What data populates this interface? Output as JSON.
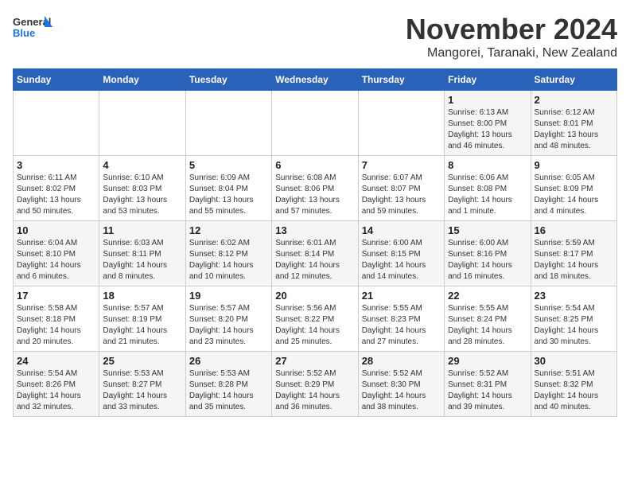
{
  "logo": {
    "line1": "General",
    "line2": "Blue"
  },
  "title": "November 2024",
  "subtitle": "Mangorei, Taranaki, New Zealand",
  "days_of_week": [
    "Sunday",
    "Monday",
    "Tuesday",
    "Wednesday",
    "Thursday",
    "Friday",
    "Saturday"
  ],
  "weeks": [
    [
      {
        "day": "",
        "info": ""
      },
      {
        "day": "",
        "info": ""
      },
      {
        "day": "",
        "info": ""
      },
      {
        "day": "",
        "info": ""
      },
      {
        "day": "",
        "info": ""
      },
      {
        "day": "1",
        "info": "Sunrise: 6:13 AM\nSunset: 8:00 PM\nDaylight: 13 hours and 46 minutes."
      },
      {
        "day": "2",
        "info": "Sunrise: 6:12 AM\nSunset: 8:01 PM\nDaylight: 13 hours and 48 minutes."
      }
    ],
    [
      {
        "day": "3",
        "info": "Sunrise: 6:11 AM\nSunset: 8:02 PM\nDaylight: 13 hours and 50 minutes."
      },
      {
        "day": "4",
        "info": "Sunrise: 6:10 AM\nSunset: 8:03 PM\nDaylight: 13 hours and 53 minutes."
      },
      {
        "day": "5",
        "info": "Sunrise: 6:09 AM\nSunset: 8:04 PM\nDaylight: 13 hours and 55 minutes."
      },
      {
        "day": "6",
        "info": "Sunrise: 6:08 AM\nSunset: 8:06 PM\nDaylight: 13 hours and 57 minutes."
      },
      {
        "day": "7",
        "info": "Sunrise: 6:07 AM\nSunset: 8:07 PM\nDaylight: 13 hours and 59 minutes."
      },
      {
        "day": "8",
        "info": "Sunrise: 6:06 AM\nSunset: 8:08 PM\nDaylight: 14 hours and 1 minute."
      },
      {
        "day": "9",
        "info": "Sunrise: 6:05 AM\nSunset: 8:09 PM\nDaylight: 14 hours and 4 minutes."
      }
    ],
    [
      {
        "day": "10",
        "info": "Sunrise: 6:04 AM\nSunset: 8:10 PM\nDaylight: 14 hours and 6 minutes."
      },
      {
        "day": "11",
        "info": "Sunrise: 6:03 AM\nSunset: 8:11 PM\nDaylight: 14 hours and 8 minutes."
      },
      {
        "day": "12",
        "info": "Sunrise: 6:02 AM\nSunset: 8:12 PM\nDaylight: 14 hours and 10 minutes."
      },
      {
        "day": "13",
        "info": "Sunrise: 6:01 AM\nSunset: 8:14 PM\nDaylight: 14 hours and 12 minutes."
      },
      {
        "day": "14",
        "info": "Sunrise: 6:00 AM\nSunset: 8:15 PM\nDaylight: 14 hours and 14 minutes."
      },
      {
        "day": "15",
        "info": "Sunrise: 6:00 AM\nSunset: 8:16 PM\nDaylight: 14 hours and 16 minutes."
      },
      {
        "day": "16",
        "info": "Sunrise: 5:59 AM\nSunset: 8:17 PM\nDaylight: 14 hours and 18 minutes."
      }
    ],
    [
      {
        "day": "17",
        "info": "Sunrise: 5:58 AM\nSunset: 8:18 PM\nDaylight: 14 hours and 20 minutes."
      },
      {
        "day": "18",
        "info": "Sunrise: 5:57 AM\nSunset: 8:19 PM\nDaylight: 14 hours and 21 minutes."
      },
      {
        "day": "19",
        "info": "Sunrise: 5:57 AM\nSunset: 8:20 PM\nDaylight: 14 hours and 23 minutes."
      },
      {
        "day": "20",
        "info": "Sunrise: 5:56 AM\nSunset: 8:22 PM\nDaylight: 14 hours and 25 minutes."
      },
      {
        "day": "21",
        "info": "Sunrise: 5:55 AM\nSunset: 8:23 PM\nDaylight: 14 hours and 27 minutes."
      },
      {
        "day": "22",
        "info": "Sunrise: 5:55 AM\nSunset: 8:24 PM\nDaylight: 14 hours and 28 minutes."
      },
      {
        "day": "23",
        "info": "Sunrise: 5:54 AM\nSunset: 8:25 PM\nDaylight: 14 hours and 30 minutes."
      }
    ],
    [
      {
        "day": "24",
        "info": "Sunrise: 5:54 AM\nSunset: 8:26 PM\nDaylight: 14 hours and 32 minutes."
      },
      {
        "day": "25",
        "info": "Sunrise: 5:53 AM\nSunset: 8:27 PM\nDaylight: 14 hours and 33 minutes."
      },
      {
        "day": "26",
        "info": "Sunrise: 5:53 AM\nSunset: 8:28 PM\nDaylight: 14 hours and 35 minutes."
      },
      {
        "day": "27",
        "info": "Sunrise: 5:52 AM\nSunset: 8:29 PM\nDaylight: 14 hours and 36 minutes."
      },
      {
        "day": "28",
        "info": "Sunrise: 5:52 AM\nSunset: 8:30 PM\nDaylight: 14 hours and 38 minutes."
      },
      {
        "day": "29",
        "info": "Sunrise: 5:52 AM\nSunset: 8:31 PM\nDaylight: 14 hours and 39 minutes."
      },
      {
        "day": "30",
        "info": "Sunrise: 5:51 AM\nSunset: 8:32 PM\nDaylight: 14 hours and 40 minutes."
      }
    ]
  ]
}
